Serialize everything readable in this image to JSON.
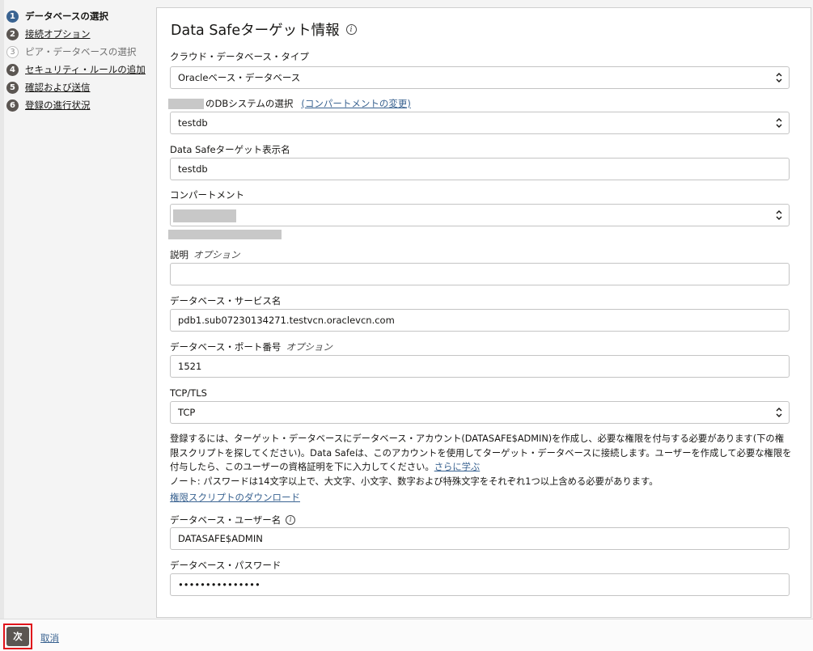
{
  "steps": [
    {
      "num": "1",
      "label": "データベースの選択",
      "state": "active"
    },
    {
      "num": "2",
      "label": "接続オプション",
      "state": "link"
    },
    {
      "num": "3",
      "label": "ピア・データベースの選択",
      "state": "disabled"
    },
    {
      "num": "4",
      "label": "セキュリティ・ルールの追加",
      "state": "link"
    },
    {
      "num": "5",
      "label": "確認および送信",
      "state": "link"
    },
    {
      "num": "6",
      "label": "登録の進行状況",
      "state": "link"
    }
  ],
  "panel": {
    "title": "Data Safeターゲット情報",
    "info_icon": "i"
  },
  "fields": {
    "cloud_db_type": {
      "label": "クラウド・データベース・タイプ",
      "value": "Oracleベース・データベース"
    },
    "db_system": {
      "label": "のDBシステムの選択",
      "link": "(コンパートメントの変更)",
      "value": "testdb"
    },
    "display_name": {
      "label": "Data Safeターゲット表示名",
      "value": "testdb"
    },
    "compartment": {
      "label": "コンパートメント"
    },
    "description": {
      "label": "説明",
      "optional": "オプション",
      "value": ""
    },
    "service_name": {
      "label": "データベース・サービス名",
      "value": "pdb1.sub07230134271.testvcn.oraclevcn.com"
    },
    "port": {
      "label": "データベース・ポート番号",
      "optional": "オプション",
      "value": "1521"
    },
    "tcp_tls": {
      "label": "TCP/TLS",
      "value": "TCP"
    },
    "db_user": {
      "label": "データベース・ユーザー名",
      "value": "DATASAFE$ADMIN"
    },
    "db_password": {
      "label": "データベース・パスワード",
      "value": "•••••••••••••••"
    }
  },
  "description_text": {
    "main": "登録するには、ターゲット・データベースにデータベース・アカウント(DATASAFE$ADMIN)を作成し、必要な権限を付与する必要があります(下の権限スクリプトを探してください)。Data Safeは、このアカウントを使用してターゲット・データベースに接続します。ユーザーを作成して必要な権限を付与したら、このユーザーの資格証明を下に入力してください。",
    "learn_more": "さらに学ぶ",
    "note": "ノート: パスワードは14文字以上で、大文字、小文字、数字および特殊文字をそれぞれ1つ以上含める必要があります。",
    "download_link": "権限スクリプトのダウンロード"
  },
  "footer": {
    "next_label": "次",
    "cancel_label": "取消"
  },
  "colors": {
    "accent": "#3a6391",
    "button_bg": "#5b5652",
    "highlight": "#e0121a"
  }
}
